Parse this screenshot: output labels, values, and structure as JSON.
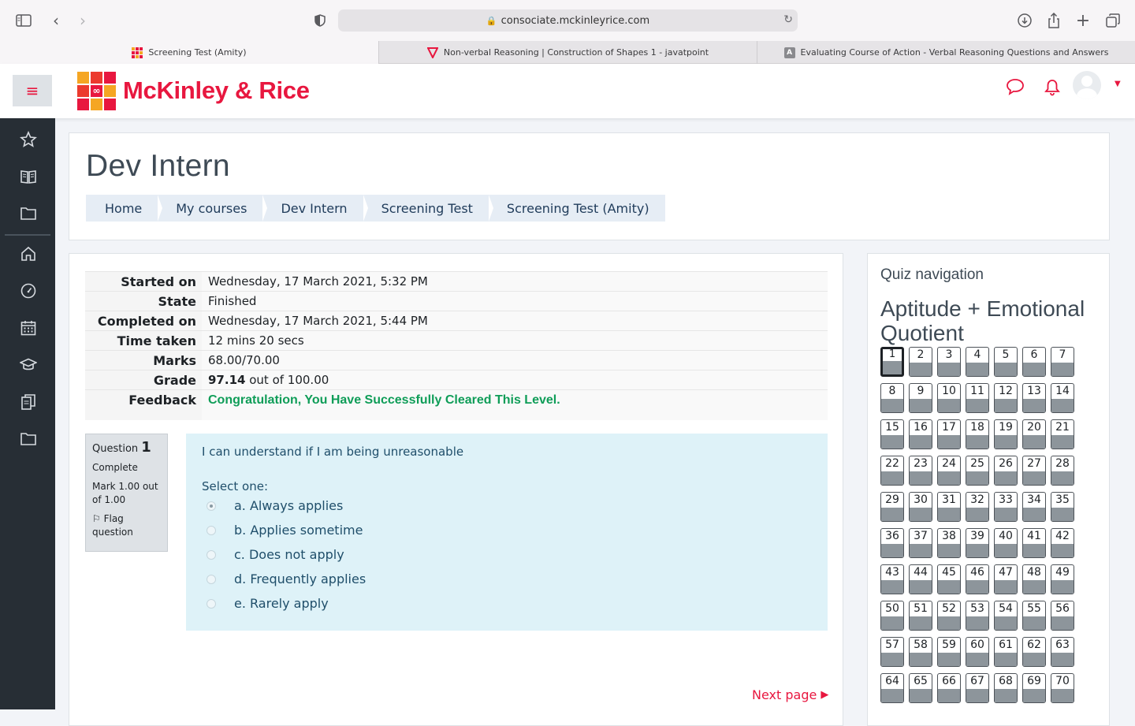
{
  "browser": {
    "url": "consociate.mckinleyrice.com",
    "tabs": [
      {
        "title": "Screening Test (Amity)",
        "active": true
      },
      {
        "title": "Non-verbal Reasoning | Construction of Shapes 1 - javatpoint",
        "active": false
      },
      {
        "title": "Evaluating Course of Action - Verbal Reasoning Questions and Answers",
        "active": false
      }
    ]
  },
  "brand": {
    "name": "McKinley & Rice",
    "color": "#e8173f"
  },
  "page": {
    "title": "Dev Intern",
    "breadcrumb": [
      "Home",
      "My courses",
      "Dev Intern",
      "Screening Test",
      "Screening Test (Amity)"
    ]
  },
  "summary": {
    "started_label": "Started on",
    "started": "Wednesday, 17 March 2021, 5:32 PM",
    "state_label": "State",
    "state": "Finished",
    "completed_label": "Completed on",
    "completed": "Wednesday, 17 March 2021, 5:44 PM",
    "time_label": "Time taken",
    "time": "12 mins 20 secs",
    "marks_label": "Marks",
    "marks": "68.00/70.00",
    "grade_label": "Grade",
    "grade_value": "97.14",
    "grade_rest": "out of 100.00",
    "feedback_label": "Feedback",
    "feedback": "Congratulation, You Have Successfully Cleared This Level."
  },
  "question": {
    "label": "Question",
    "number": "1",
    "status": "Complete",
    "mark": "Mark 1.00 out of 1.00",
    "flag": "Flag question",
    "text": "I can understand if I am being unreasonable",
    "select_label": "Select one:",
    "options": [
      "a. Always applies",
      "b. Applies sometime",
      "c. Does not apply",
      "d. Frequently applies",
      "e. Rarely apply"
    ],
    "selected_index": 0
  },
  "next_page": "Next page",
  "quiz_nav": {
    "title": "Quiz navigation",
    "section": "Aptitude + Emotional Quotient",
    "count": 70,
    "current": 1
  }
}
